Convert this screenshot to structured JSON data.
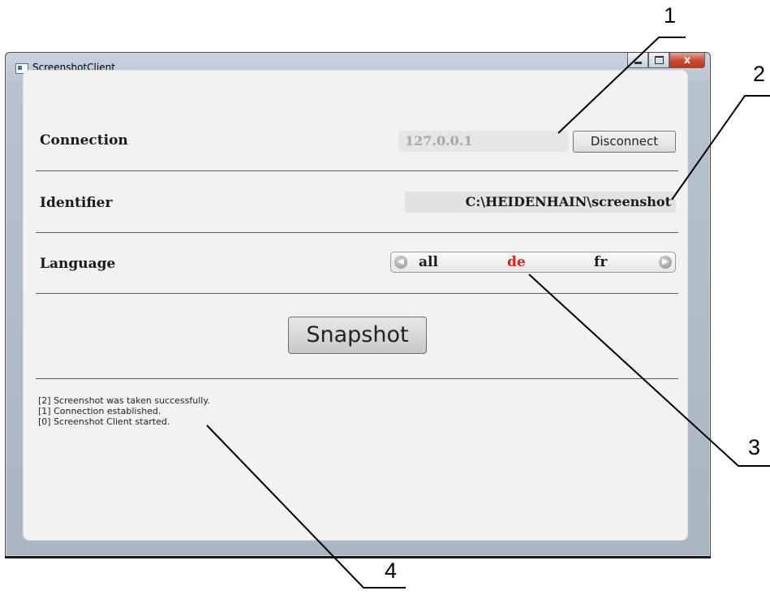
{
  "window": {
    "title": "ScreenshotClient",
    "controls": {
      "minimize": "minimize",
      "maximize": "maximize",
      "close": "x"
    }
  },
  "connection": {
    "label": "Connection",
    "ip_value": "127.0.0.1",
    "disconnect_label": "Disconnect"
  },
  "identifier": {
    "label": "Identifier",
    "value": "C:\\HEIDENHAIN\\screenshot"
  },
  "language": {
    "label": "Language",
    "options": [
      "all",
      "de",
      "fr"
    ],
    "selected": "de",
    "selected_color": "#e0201a"
  },
  "snapshot_label": "Snapshot",
  "log": [
    "[2] Screenshot was taken successfully.",
    "[1] Connection established.",
    "[0] Screenshot Client started."
  ],
  "callouts": [
    "1",
    "2",
    "3",
    "4"
  ]
}
